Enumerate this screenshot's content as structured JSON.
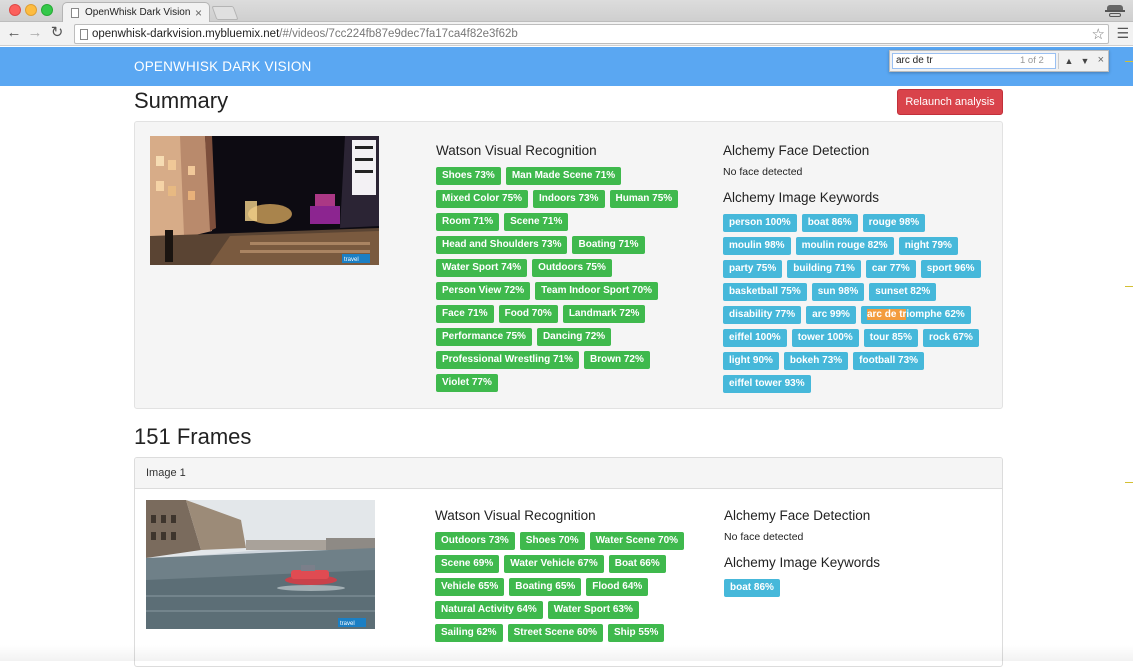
{
  "browser": {
    "tab_title": "OpenWhisk Dark Vision",
    "url_host": "openwhisk-darkvision.mybluemix.net",
    "url_path": "/#/videos/7cc224fb87e9dec7fa17ca4f82e3f62b",
    "find": {
      "query": "arc de tr",
      "count": "1 of 2"
    }
  },
  "app": {
    "brand": "OPENWHISK DARK VISION",
    "summary_title": "Summary",
    "relaunch_label": "Relaunch analysis",
    "frames_title": "151 Frames"
  },
  "summary": {
    "watson_title": "Watson Visual Recognition",
    "watson_tags": [
      "Shoes 73%",
      "Man Made Scene 71%",
      "Mixed Color 75%",
      "Indoors 73%",
      "Human 75%",
      "Room 71%",
      "Scene 71%",
      "Head and Shoulders 73%",
      "Boating 71%",
      "Water Sport 74%",
      "Outdoors 75%",
      "Person View 72%",
      "Team Indoor Sport 70%",
      "Face 71%",
      "Food 70%",
      "Landmark 72%",
      "Performance 75%",
      "Dancing 72%",
      "Professional Wrestling 71%",
      "Brown 72%",
      "Violet 77%"
    ],
    "face_title": "Alchemy Face Detection",
    "face_note": "No face detected",
    "keywords_title": "Alchemy Image Keywords",
    "keyword_tags": [
      "person 100%",
      "boat 86%",
      "rouge 98%",
      "moulin 98%",
      "moulin rouge 82%",
      "night 79%",
      "party 75%",
      "building 71%",
      "car 77%",
      "sport 96%",
      "basketball 75%",
      "sun 98%",
      "sunset 82%",
      "disability 77%",
      "arc 99%",
      "arc de triomphe 62%",
      "eiffel 100%",
      "tower 100%",
      "tour 85%",
      "rock 67%",
      "light 90%",
      "bokeh 73%",
      "football 73%",
      "eiffel tower 93%"
    ],
    "highlight_index": 15,
    "highlight_text": "arc de tr",
    "highlight_rest": "iomphe 62%"
  },
  "frame1": {
    "label": "Image 1",
    "watson_title": "Watson Visual Recognition",
    "watson_tags": [
      "Outdoors 73%",
      "Shoes 70%",
      "Water Scene 70%",
      "Scene 69%",
      "Water Vehicle 67%",
      "Boat 66%",
      "Vehicle 65%",
      "Boating 65%",
      "Flood 64%",
      "Natural Activity 64%",
      "Water Sport 63%",
      "Sailing 62%",
      "Street Scene 60%",
      "Ship 55%"
    ],
    "face_title": "Alchemy Face Detection",
    "face_note": "No face detected",
    "keywords_title": "Alchemy Image Keywords",
    "keyword_tags": [
      "boat 86%"
    ]
  },
  "watermark": "travel"
}
